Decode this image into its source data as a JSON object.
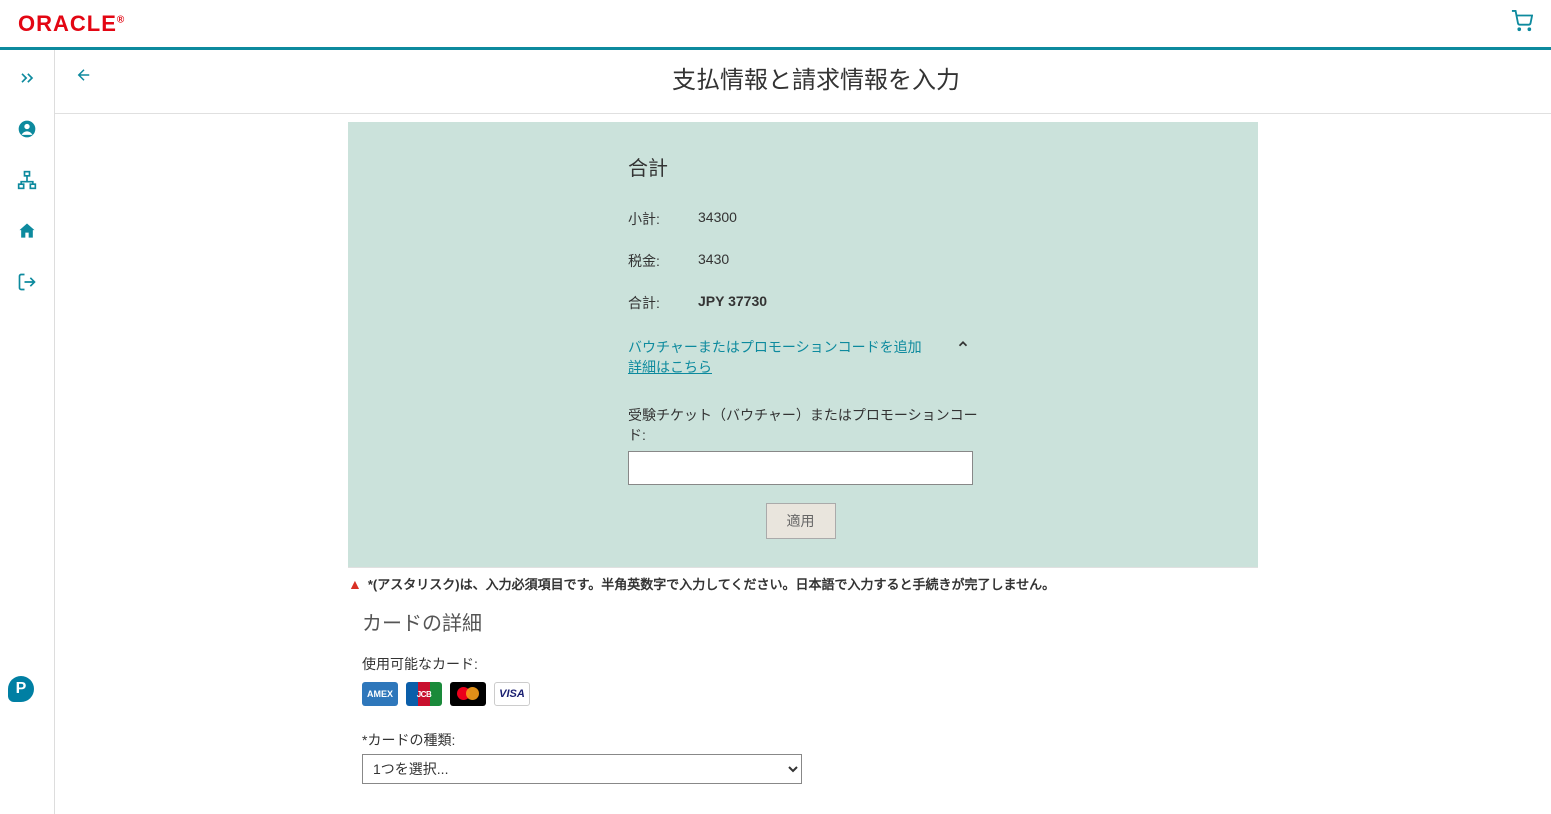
{
  "brand": {
    "logo_text": "ORACLE",
    "reg": "®"
  },
  "header": {
    "title": "支払情報と請求情報を入力"
  },
  "summary": {
    "title": "合計",
    "rows": {
      "subtotal_label": "小計:",
      "subtotal_value": "34300",
      "tax_label": "税金:",
      "tax_value": "3430",
      "total_label": "合計:",
      "total_value": "JPY 37730"
    },
    "promo_toggle_text": "バウチャーまたはプロモーションコードを追加",
    "promo_more_link": "詳細はこちら",
    "promo_input_label": "受験チケット（バウチャー）またはプロモーションコード:",
    "apply_button": "適用"
  },
  "warning": {
    "text": "*(アスタリスク)は、入力必須項目です。半角英数字で入力してください。日本語で入力すると手続きが完了しません。"
  },
  "card": {
    "section_title": "カードの詳細",
    "available_label": "使用可能なカード:",
    "logos": {
      "amex": "AMEX",
      "jcb": "JCB",
      "mc": "",
      "visa": "VISA"
    },
    "type_label": "*カードの種類:",
    "type_select_placeholder": "1つを選択..."
  },
  "pearson": {
    "letter": "P"
  }
}
